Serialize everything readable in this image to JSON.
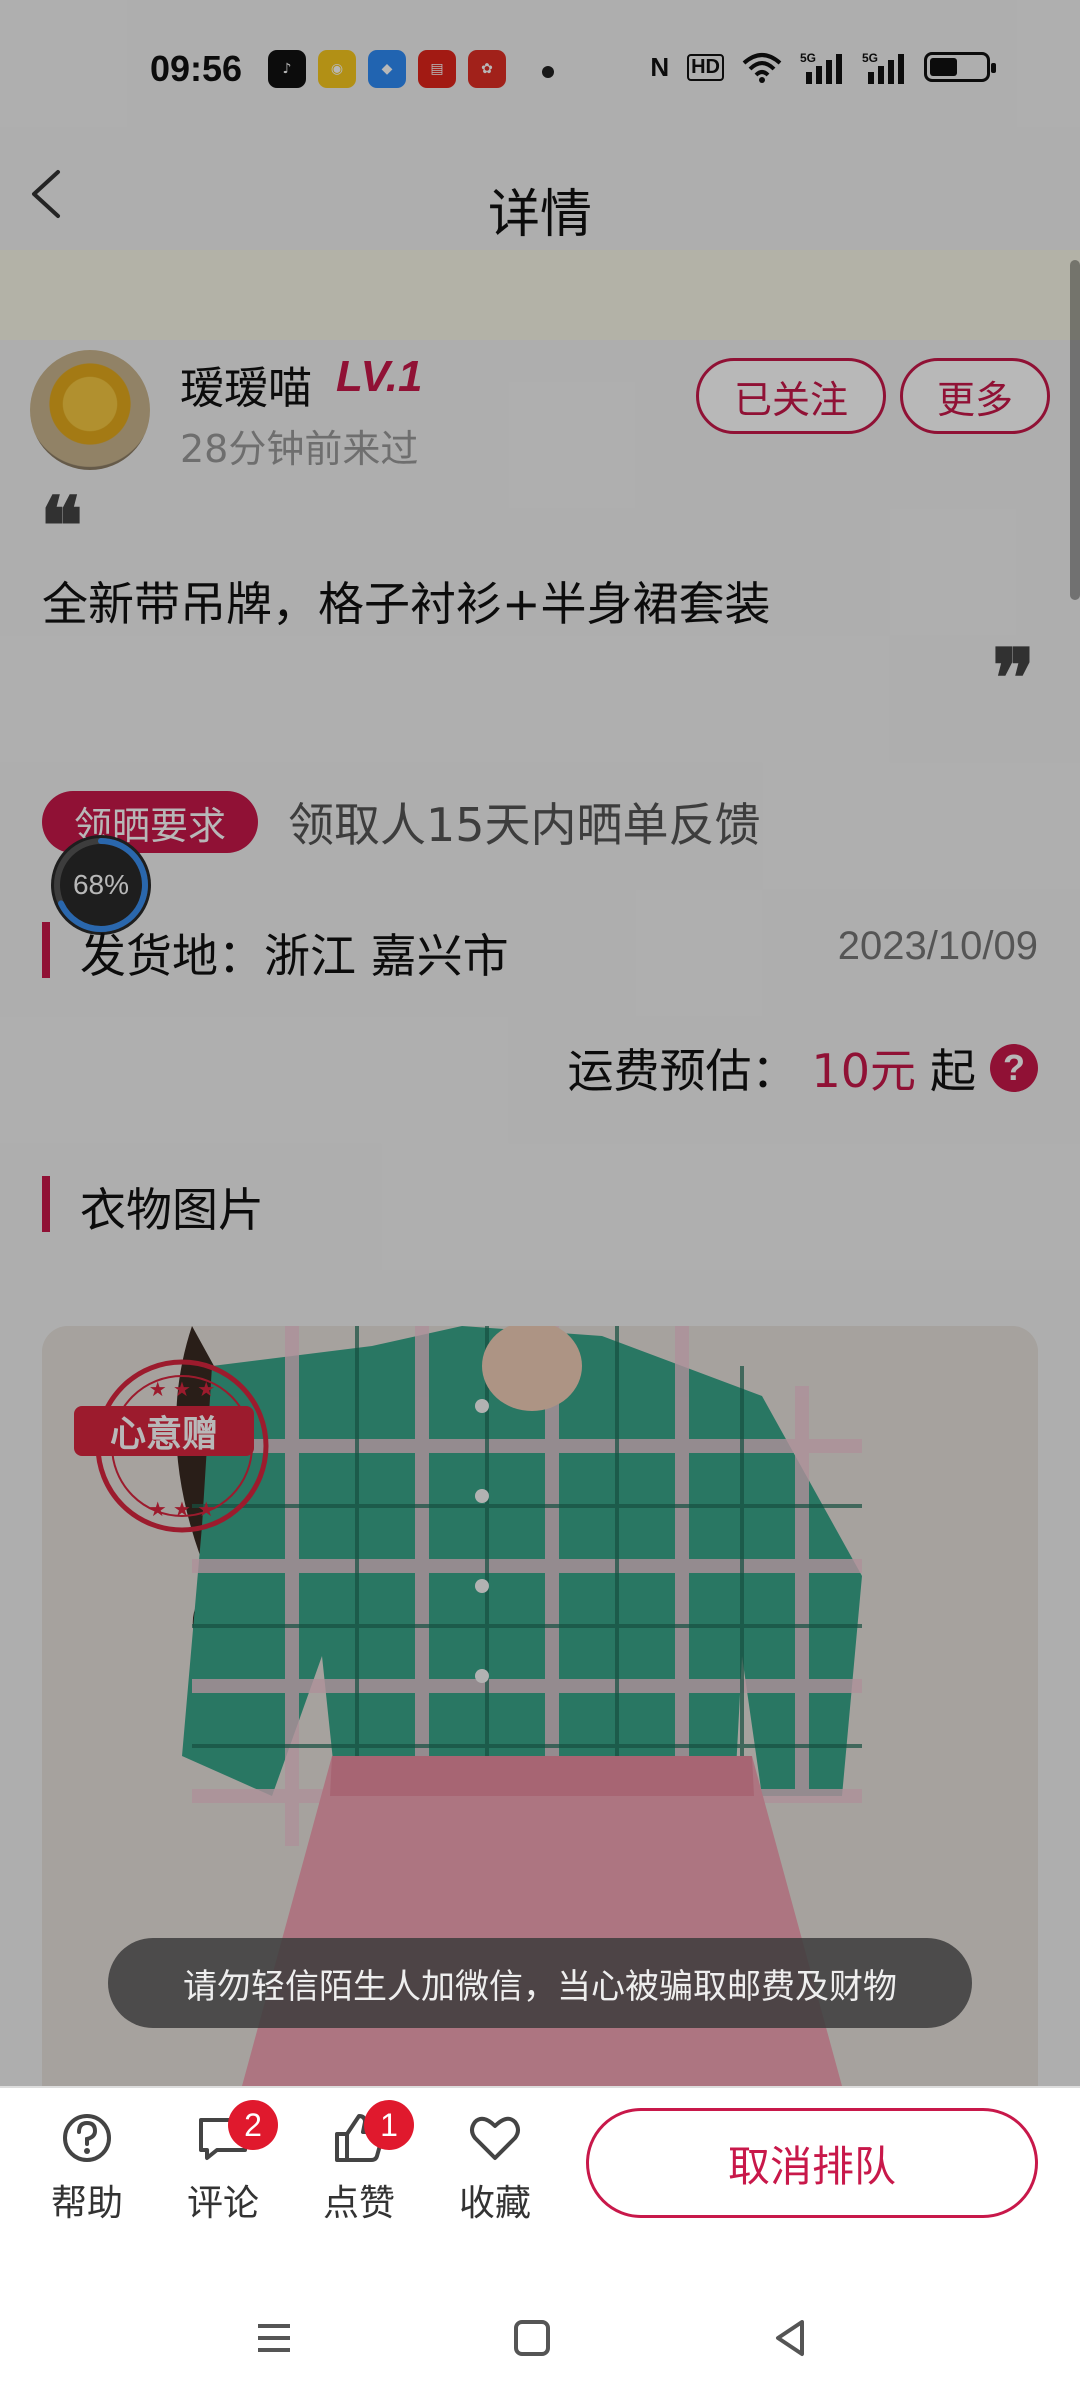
{
  "status_bar": {
    "time": "09:56",
    "app_icons": [
      "douyin-icon",
      "weibo-icon",
      "blue-app-icon",
      "toutiao-icon",
      "pinduoduo-icon"
    ],
    "network": [
      "nfc-icon",
      "hd-icon",
      "wifi-icon",
      "5g-signal-icon",
      "5g-signal-icon"
    ]
  },
  "nav": {
    "title": "详情"
  },
  "user": {
    "name": "瑷瑷喵",
    "level": "LV.1",
    "last_seen": "28分钟前来过",
    "follow_label": "已关注",
    "more_label": "更多"
  },
  "post": {
    "description": "全新带吊牌，格子衬衫+半身裙套装",
    "requirement_badge": "领晒要求",
    "requirement_text": "领取人15天内晒单反馈",
    "progress_label": "68%",
    "progress_value": 0.68
  },
  "shipping": {
    "origin": "发货地：浙江 嘉兴市",
    "date": "2023/10/09",
    "fee_label": "运费预估：",
    "fee_value": "10元",
    "fee_suffix": "起",
    "help_symbol": "?"
  },
  "section": {
    "title": "衣物图片",
    "seal_text": "心意赠"
  },
  "toast": {
    "text": "请勿轻信陌生人加微信，当心被骗取邮费及财物"
  },
  "bottom_bar": {
    "help_label": "帮助",
    "comment_label": "评论",
    "comment_count": "2",
    "like_label": "点赞",
    "like_count": "1",
    "favorite_label": "收藏",
    "cancel_label": "取消排队"
  },
  "colors": {
    "accent": "#c8184a",
    "badge": "#e0192d"
  }
}
